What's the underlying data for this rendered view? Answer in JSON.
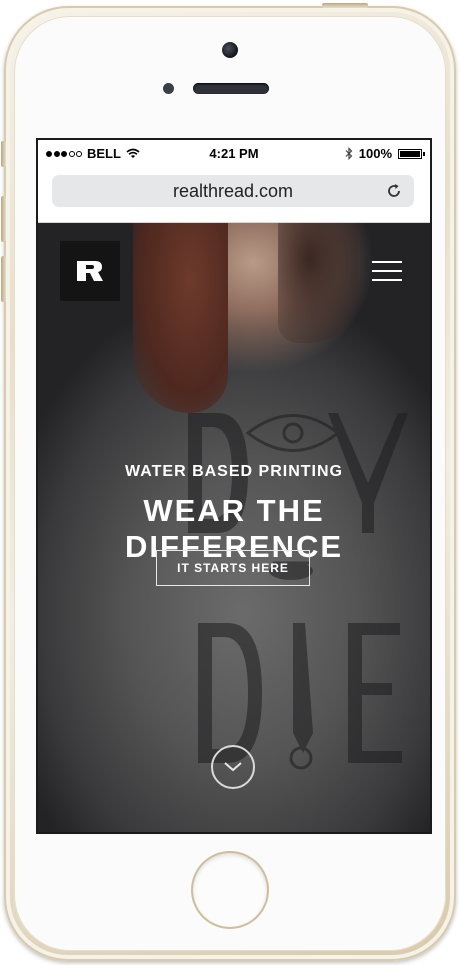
{
  "status_bar": {
    "carrier": "BELL",
    "time": "4:21 PM",
    "battery": "100%",
    "battery_level": 1.0,
    "signal_bars_filled": 3,
    "signal_bars_total": 5,
    "icons": [
      "wifi-icon",
      "bluetooth-icon",
      "battery-icon"
    ]
  },
  "browser": {
    "url": "realthread.com",
    "reload_icon": "reload-icon"
  },
  "site": {
    "logo_glyph": "R",
    "menu_icon": "hamburger-menu-icon",
    "eyebrow": "WATER BASED PRINTING",
    "headline": "WEAR THE DIFFERENCE",
    "cta_label": "IT STARTS HERE",
    "scroll_icon": "chevron-down-icon"
  },
  "colors": {
    "logo_bg": "#141414",
    "text": "#ffffff",
    "url_field_bg": "#e6e7e9",
    "phone_gold": "#d8caa9"
  }
}
